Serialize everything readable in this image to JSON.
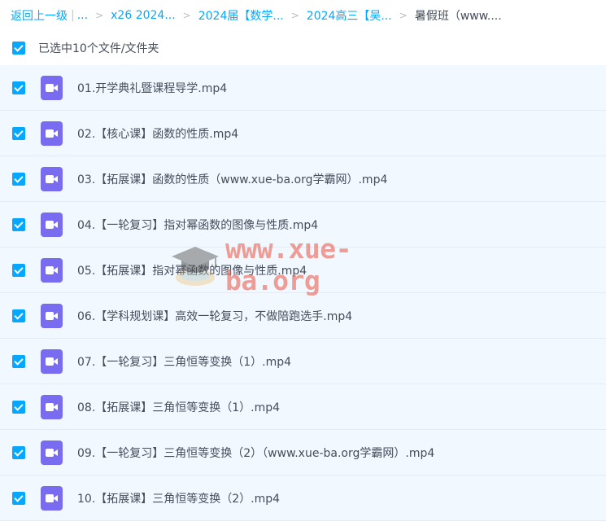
{
  "breadcrumb": {
    "back": "返回上一级",
    "ellipsis": "...",
    "items": [
      "x26 2024...",
      "2024届【数学...",
      "2024高三【吴..."
    ],
    "current": "暑假班（www...."
  },
  "selection": {
    "label": "已选中10个文件/文件夹"
  },
  "files": [
    {
      "name": "01.开学典礼暨课程导学.mp4",
      "icon": "video-icon",
      "checked": true
    },
    {
      "name": "02.【核心课】函数的性质.mp4",
      "icon": "video-icon",
      "checked": true
    },
    {
      "name": "03.【拓展课】函数的性质（www.xue-ba.org学霸网）.mp4",
      "icon": "video-icon",
      "checked": true
    },
    {
      "name": "04.【一轮复习】指对幂函数的图像与性质.mp4",
      "icon": "video-icon",
      "checked": true
    },
    {
      "name": "05.【拓展课】指对幂函数的图像与性质.mp4",
      "icon": "video-icon",
      "checked": true
    },
    {
      "name": "06.【学科规划课】高效一轮复习，不做陪跑选手.mp4",
      "icon": "video-icon",
      "checked": true
    },
    {
      "name": "07.【一轮复习】三角恒等变换（1）.mp4",
      "icon": "video-icon",
      "checked": true
    },
    {
      "name": "08.【拓展课】三角恒等变换（1）.mp4",
      "icon": "video-icon",
      "checked": true
    },
    {
      "name": "09.【一轮复习】三角恒等变换（2）（www.xue-ba.org学霸网）.mp4",
      "icon": "video-icon",
      "checked": true
    },
    {
      "name": "10.【拓展课】三角恒等变换（2）.mp4",
      "icon": "video-icon",
      "checked": true
    }
  ],
  "watermark": {
    "text": "www.xue-ba.org"
  },
  "colors": {
    "accent": "#06a7ff",
    "row_bg": "#f2f8ff",
    "video_icon": "#7a6cf0"
  }
}
